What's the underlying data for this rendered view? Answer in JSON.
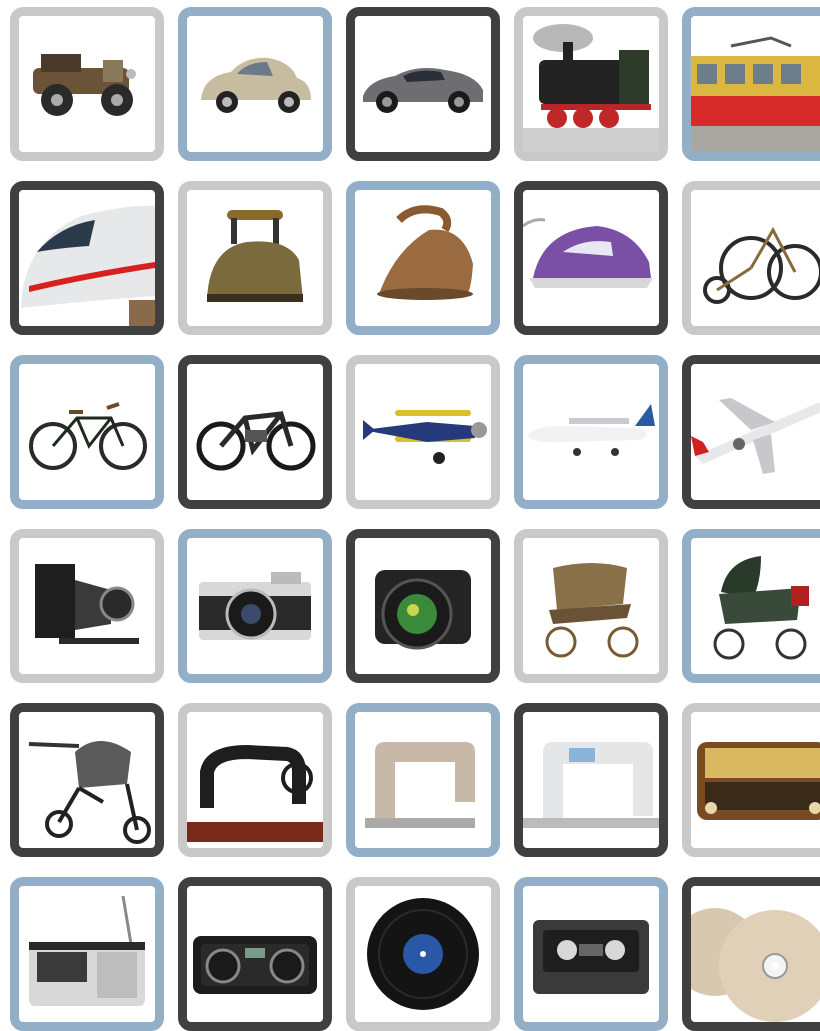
{
  "frame_colors": {
    "gray": "#c9c9c9",
    "blue": "#93aec7",
    "dark": "#404040"
  },
  "cards": [
    {
      "picture": "vintage-car",
      "frame": "gray"
    },
    {
      "picture": "beetle-car",
      "frame": "blue"
    },
    {
      "picture": "sports-car",
      "frame": "dark"
    },
    {
      "picture": "steam-locomotive",
      "frame": "gray"
    },
    {
      "picture": "tram",
      "frame": "blue"
    },
    {
      "picture": "high-speed-train",
      "frame": "dark"
    },
    {
      "picture": "antique-iron",
      "frame": "gray"
    },
    {
      "picture": "flat-iron",
      "frame": "blue"
    },
    {
      "picture": "steam-iron",
      "frame": "dark"
    },
    {
      "picture": "tricycle",
      "frame": "gray"
    },
    {
      "picture": "bicycle",
      "frame": "blue"
    },
    {
      "picture": "e-bike",
      "frame": "dark"
    },
    {
      "picture": "biplane",
      "frame": "gray"
    },
    {
      "picture": "propeller-plane",
      "frame": "blue"
    },
    {
      "picture": "jet-airliner",
      "frame": "dark"
    },
    {
      "picture": "folding-camera",
      "frame": "gray"
    },
    {
      "picture": "film-camera",
      "frame": "blue"
    },
    {
      "picture": "dslr-camera",
      "frame": "dark"
    },
    {
      "picture": "wicker-pram",
      "frame": "gray"
    },
    {
      "picture": "vintage-pram",
      "frame": "blue"
    },
    {
      "picture": "jogging-stroller",
      "frame": "dark"
    },
    {
      "picture": "treadle-sewing-machine",
      "frame": "gray"
    },
    {
      "picture": "vintage-sewing-machine",
      "frame": "blue"
    },
    {
      "picture": "modern-sewing-machine",
      "frame": "dark"
    },
    {
      "picture": "tube-radio",
      "frame": "gray"
    },
    {
      "picture": "cassette-radio",
      "frame": "blue"
    },
    {
      "picture": "boombox",
      "frame": "dark"
    },
    {
      "picture": "vinyl-record",
      "frame": "gray"
    },
    {
      "picture": "cassette-tape",
      "frame": "blue"
    },
    {
      "picture": "compact-discs",
      "frame": "dark"
    }
  ]
}
